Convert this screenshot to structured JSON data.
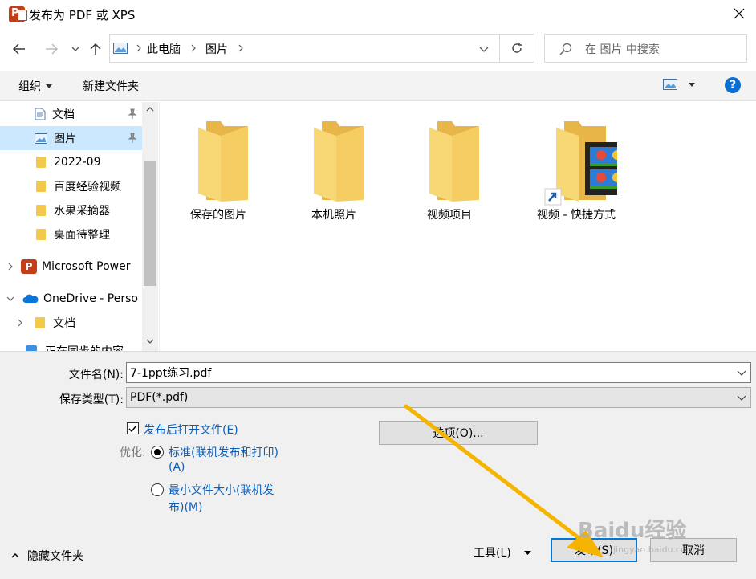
{
  "window": {
    "title": "发布为 PDF 或 XPS"
  },
  "address": {
    "segments": [
      "此电脑",
      "图片"
    ]
  },
  "search": {
    "placeholder": "在 图片 中搜索"
  },
  "toolbar": {
    "organize": "组织",
    "new_folder": "新建文件夹",
    "help": "?"
  },
  "nav": {
    "items": [
      {
        "label": "文档",
        "icon": "document-icon",
        "pinned": true
      },
      {
        "label": "图片",
        "icon": "pictures-icon",
        "pinned": true,
        "selected": true
      },
      {
        "label": "2022-09",
        "icon": "folder-icon"
      },
      {
        "label": "百度经验视频",
        "icon": "folder-icon"
      },
      {
        "label": "水果采摘器",
        "icon": "folder-icon"
      },
      {
        "label": "桌面待整理",
        "icon": "folder-icon"
      },
      {
        "label": "Microsoft Power",
        "icon": "powerpoint-icon",
        "expander": "collapsed"
      },
      {
        "label": "OneDrive - Perso",
        "icon": "onedrive-icon",
        "expander": "expanded"
      },
      {
        "label": "文档",
        "icon": "folder-icon",
        "expander": "collapsed"
      },
      {
        "label": "正在同步的内容",
        "icon": "sync-icon"
      }
    ]
  },
  "files": [
    {
      "name": "保存的图片",
      "type": "folder"
    },
    {
      "name": "本机照片",
      "type": "folder"
    },
    {
      "name": "视频项目",
      "type": "folder"
    },
    {
      "name": "视频 - 快捷方式",
      "type": "shortcut"
    }
  ],
  "form": {
    "filename_label": "文件名(N):",
    "filename_value": "7-1ppt练习.pdf",
    "filetype_label": "保存类型(T):",
    "filetype_value": "PDF(*.pdf)",
    "open_after_publish": "发布后打开文件(E)",
    "open_after_publish_checked": true,
    "optimize_label": "优化:",
    "option_standard_line1": "标准(联机发布和打印)",
    "option_standard_line2": "(A)",
    "option_minimum_line1": "最小文件大小(联机发",
    "option_minimum_line2": "布)(M)",
    "options_button": "选项(O)...",
    "hide_folders": "隐藏文件夹",
    "tools": "工具(L)",
    "publish": "发布(S)",
    "cancel": "取消"
  },
  "watermark": {
    "brand": "Baidu经验",
    "url": "jingyan.baidu.com"
  },
  "colors": {
    "accent": "#0b5fb8",
    "selection": "#cce8ff",
    "folder": "#f2c94c",
    "arrow": "#f5b400"
  }
}
